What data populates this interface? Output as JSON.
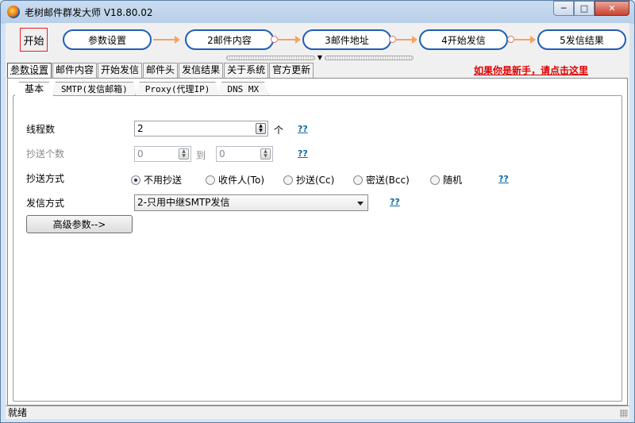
{
  "window": {
    "title": "老树邮件群发大师 V18.80.02",
    "controls": {
      "minimize": "─",
      "maximize": "□",
      "close": "✕"
    }
  },
  "flow": {
    "start": "开始",
    "steps": [
      "参数设置",
      "2邮件内容",
      "3邮件地址",
      "4开始发信",
      "5发信结果"
    ]
  },
  "tabs": [
    "参数设置",
    "邮件内容",
    "开始发信",
    "邮件头",
    "发信结果",
    "关于系统",
    "官方更新"
  ],
  "help_link": "如果你是新手，请点击这里",
  "subtabs": [
    "基本",
    "SMTP(发信邮箱)",
    "Proxy(代理IP)",
    "DNS MX"
  ],
  "form": {
    "threads": {
      "label": "线程数",
      "value": "2",
      "unit": "个",
      "help": "??"
    },
    "cc_count": {
      "label": "抄送个数",
      "from": "0",
      "to_label": "到",
      "to": "0",
      "help": "??"
    },
    "cc_mode": {
      "label": "抄送方式",
      "options": [
        "不用抄送",
        "收件人(To)",
        "抄送(Cc)",
        "密送(Bcc)",
        "随机"
      ],
      "selected": 0,
      "help": "??"
    },
    "send_mode": {
      "label": "发信方式",
      "value": "2-只用中继SMTP发信",
      "help": "??"
    },
    "advanced_button": "高级参数-->"
  },
  "status": "就绪"
}
